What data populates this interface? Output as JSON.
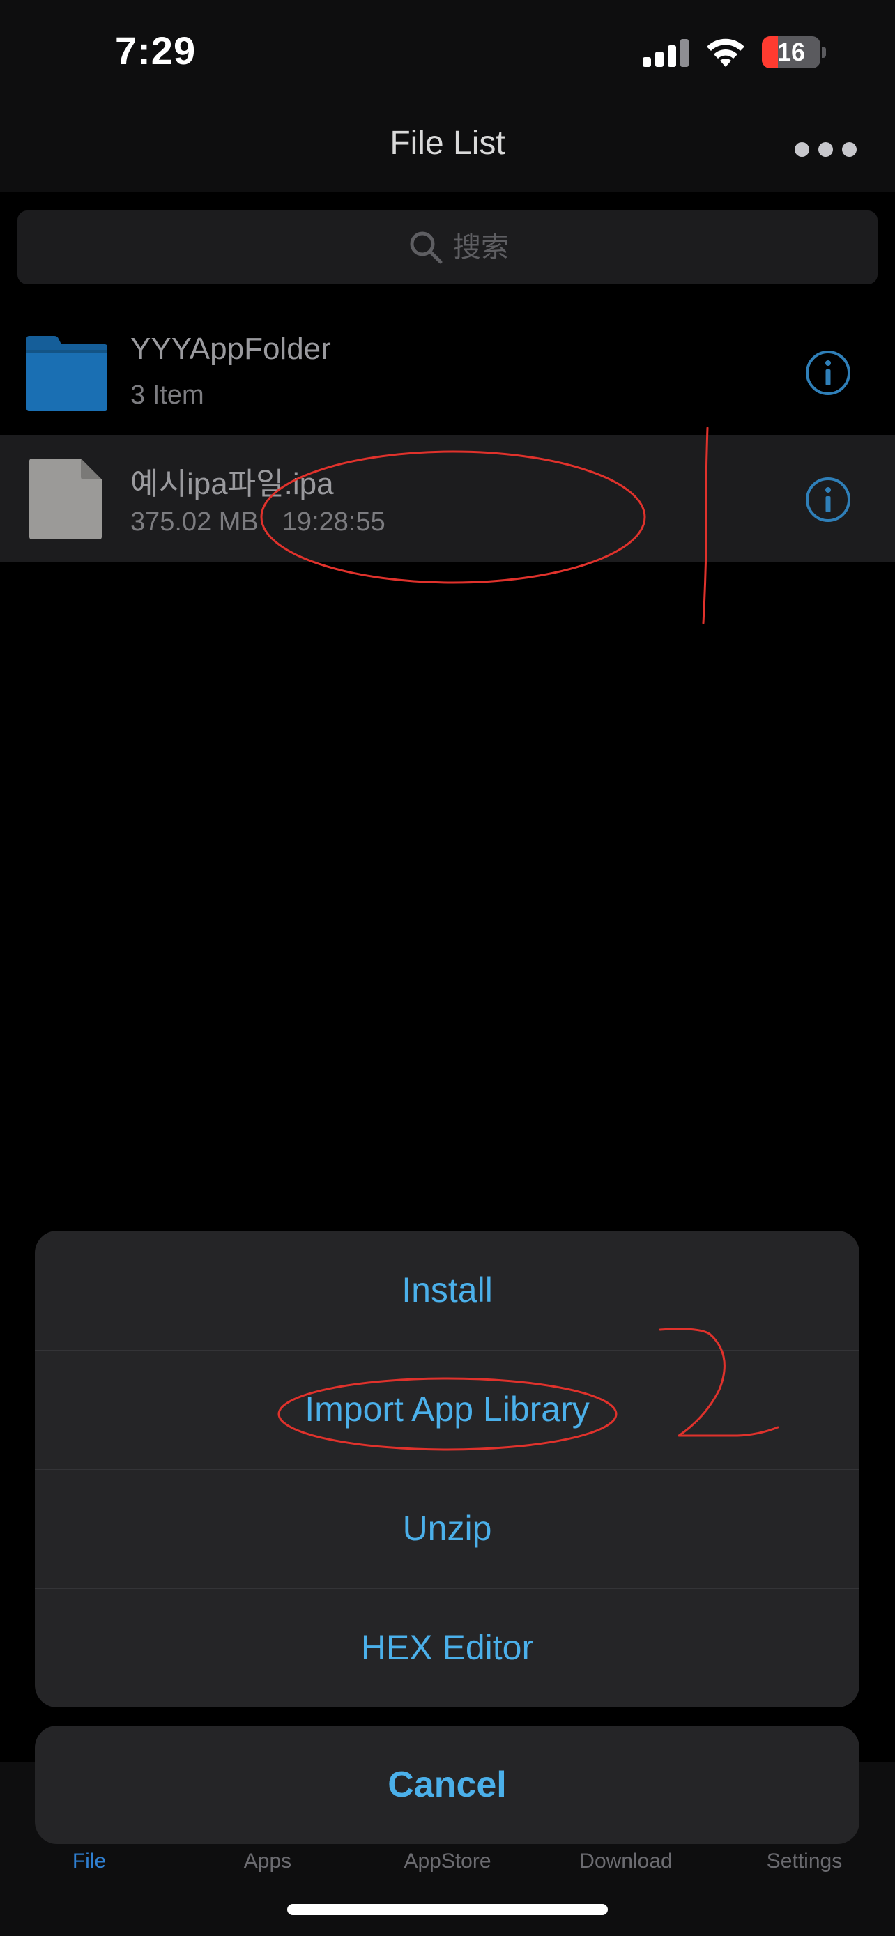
{
  "status_bar": {
    "time": "7:29",
    "battery_level": "16",
    "battery_percent": 16,
    "battery_color": "#ff3b30"
  },
  "nav": {
    "title": "File List",
    "more_icon": "ellipsis-icon"
  },
  "search": {
    "placeholder": "搜索",
    "value": ""
  },
  "files": [
    {
      "name": "YYYAppFolder",
      "meta_primary": "3 Item",
      "meta_secondary": "",
      "type": "folder",
      "icon": "folder-icon",
      "info_icon": "info-icon"
    },
    {
      "name": "예시ipa파일.ipa",
      "meta_primary": "375.02 MB",
      "meta_secondary": "19:28:55",
      "type": "file",
      "icon": "document-icon",
      "info_icon": "info-icon"
    }
  ],
  "action_sheet": {
    "items": [
      "Install",
      "Import App Library",
      "Unzip",
      "HEX Editor"
    ],
    "cancel": "Cancel"
  },
  "tab_bar": {
    "tabs": [
      {
        "label": "File",
        "active": true
      },
      {
        "label": "Apps",
        "active": false
      },
      {
        "label": "AppStore",
        "active": false
      },
      {
        "label": "Download",
        "active": false
      },
      {
        "label": "Settings",
        "active": false
      }
    ]
  },
  "colors": {
    "accent": "#4bb0ea",
    "folder": "#1a6fb3",
    "annotation": "#e0322c"
  }
}
